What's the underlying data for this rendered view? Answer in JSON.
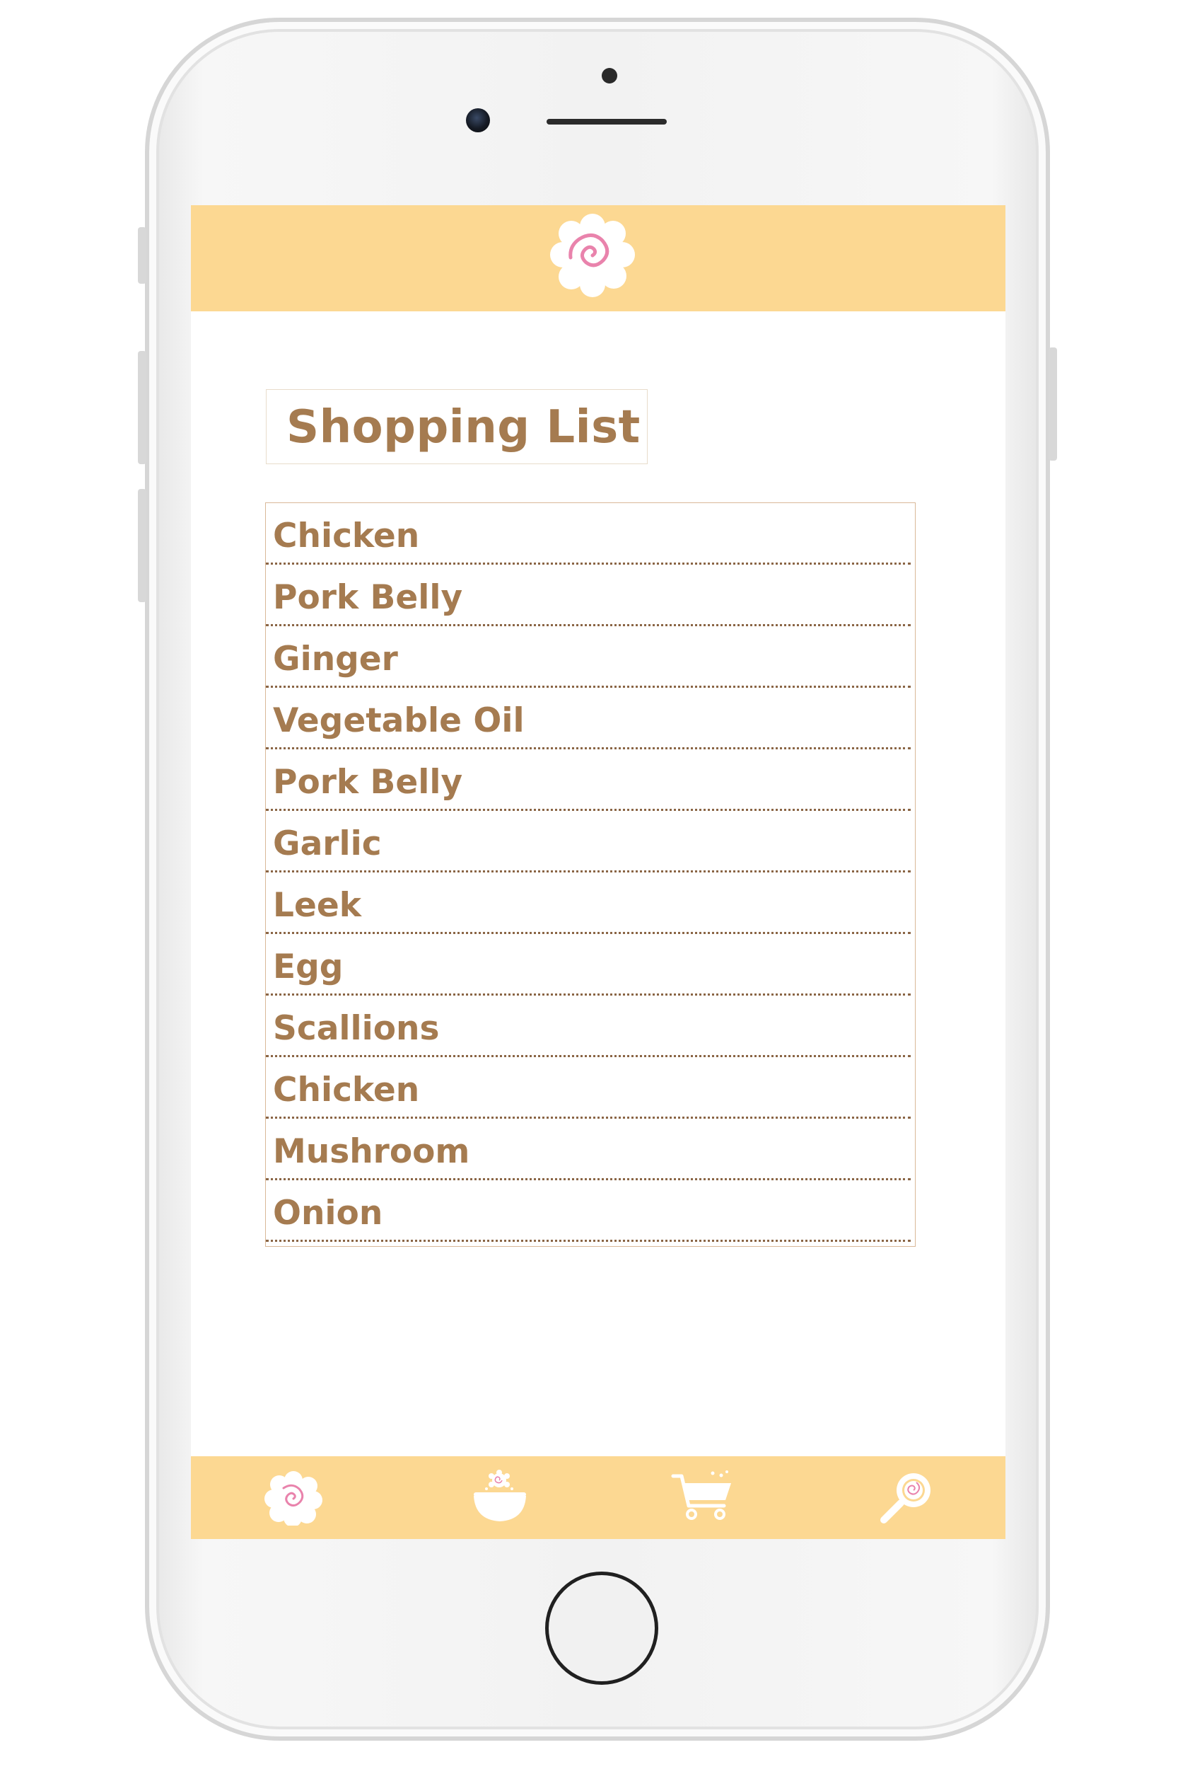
{
  "header": {
    "logo_icon": "naruto-fishcake-icon",
    "accent_color": "#fcd892"
  },
  "title": "Shopping List",
  "items": [
    "Chicken",
    "Pork Belly",
    "Ginger",
    "Vegetable Oil",
    "Pork Belly",
    "Garlic",
    "Leek",
    "Egg",
    "Scallions",
    "Chicken",
    "Mushroom",
    "Onion"
  ],
  "nav": [
    {
      "icon": "naruto-fishcake-icon"
    },
    {
      "icon": "ramen-bowl-icon"
    },
    {
      "icon": "shopping-cart-icon"
    },
    {
      "icon": "search-icon"
    }
  ],
  "colors": {
    "text": "#a57b50",
    "bar": "#fcd892",
    "pink": "#e983ac"
  }
}
